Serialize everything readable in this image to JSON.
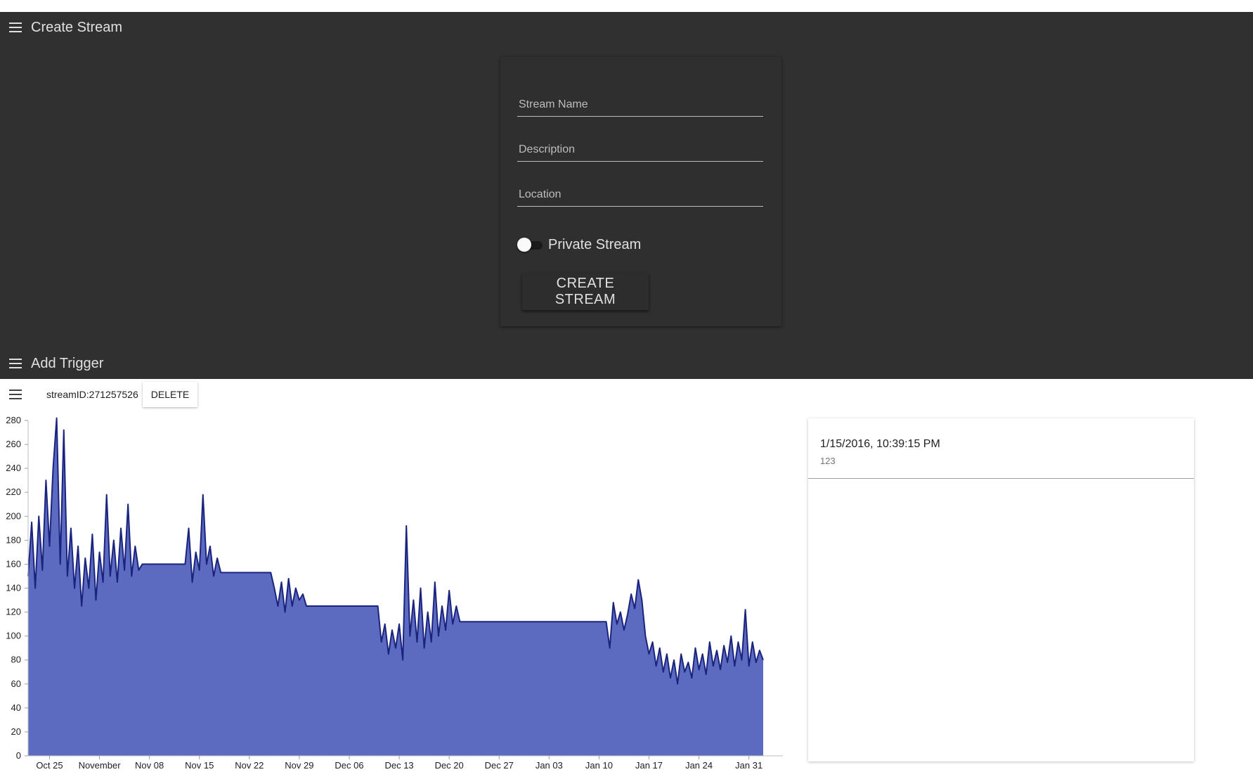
{
  "create_stream": {
    "title": "Create Stream",
    "stream_name_placeholder": "Stream Name",
    "description_placeholder": "Description",
    "location_placeholder": "Location",
    "private_label": "Private Stream",
    "private_enabled": false,
    "create_button": "CREATE STREAM"
  },
  "add_trigger": {
    "title": "Add Trigger"
  },
  "stream_toolbar": {
    "stream_id": "streamID:271257526",
    "delete_button": "DELETE"
  },
  "side_list": {
    "items": [
      {
        "timestamp": "1/15/2016, 10:39:15 PM",
        "value": "123"
      }
    ]
  },
  "colors": {
    "dark_background": "#303030",
    "area_fill": "#5c6bc0",
    "line_stroke": "#1a237e"
  },
  "chart_data": {
    "type": "area",
    "title": "",
    "xlabel": "",
    "ylabel": "",
    "ylim": [
      0,
      280
    ],
    "yticks": [
      0,
      20,
      40,
      60,
      80,
      100,
      120,
      140,
      160,
      180,
      200,
      220,
      240,
      260,
      280
    ],
    "x_range": [
      "2015-10-22",
      "2016-02-02"
    ],
    "xticks": [
      {
        "date": "2015-10-25",
        "label": "Oct 25"
      },
      {
        "date": "2015-11-01",
        "label": "November"
      },
      {
        "date": "2015-11-08",
        "label": "Nov 08"
      },
      {
        "date": "2015-11-15",
        "label": "Nov 15"
      },
      {
        "date": "2015-11-22",
        "label": "Nov 22"
      },
      {
        "date": "2015-11-29",
        "label": "Nov 29"
      },
      {
        "date": "2015-12-06",
        "label": "Dec 06"
      },
      {
        "date": "2015-12-13",
        "label": "Dec 13"
      },
      {
        "date": "2015-12-20",
        "label": "Dec 20"
      },
      {
        "date": "2015-12-27",
        "label": "Dec 27"
      },
      {
        "date": "2016-01-03",
        "label": "Jan 03"
      },
      {
        "date": "2016-01-10",
        "label": "Jan 10"
      },
      {
        "date": "2016-01-17",
        "label": "Jan 17"
      },
      {
        "date": "2016-01-24",
        "label": "Jan 24"
      },
      {
        "date": "2016-01-31",
        "label": "Jan 31"
      }
    ],
    "grid": false,
    "legend": "none",
    "series": [
      {
        "points": [
          [
            "2015-10-22",
            150
          ],
          [
            "2015-10-22T12",
            195
          ],
          [
            "2015-10-23",
            140
          ],
          [
            "2015-10-23T12",
            200
          ],
          [
            "2015-10-24",
            155
          ],
          [
            "2015-10-24T12",
            230
          ],
          [
            "2015-10-25",
            175
          ],
          [
            "2015-10-25T12",
            240
          ],
          [
            "2015-10-26",
            282
          ],
          [
            "2015-10-26T12",
            160
          ],
          [
            "2015-10-27",
            272
          ],
          [
            "2015-10-27T12",
            150
          ],
          [
            "2015-10-28",
            190
          ],
          [
            "2015-10-28T12",
            140
          ],
          [
            "2015-10-29",
            175
          ],
          [
            "2015-10-29T12",
            125
          ],
          [
            "2015-10-30",
            165
          ],
          [
            "2015-10-30T12",
            140
          ],
          [
            "2015-10-31",
            185
          ],
          [
            "2015-10-31T12",
            130
          ],
          [
            "2015-11-01",
            170
          ],
          [
            "2015-11-01T12",
            145
          ],
          [
            "2015-11-02",
            218
          ],
          [
            "2015-11-02T12",
            150
          ],
          [
            "2015-11-03",
            180
          ],
          [
            "2015-11-03T12",
            145
          ],
          [
            "2015-11-04",
            190
          ],
          [
            "2015-11-04T12",
            155
          ],
          [
            "2015-11-05",
            210
          ],
          [
            "2015-11-05T12",
            150
          ],
          [
            "2015-11-06",
            175
          ],
          [
            "2015-11-06T12",
            155
          ],
          [
            "2015-11-07",
            160
          ],
          [
            "2015-11-13",
            160
          ],
          [
            "2015-11-13T12",
            190
          ],
          [
            "2015-11-14",
            145
          ],
          [
            "2015-11-14T12",
            170
          ],
          [
            "2015-11-15",
            155
          ],
          [
            "2015-11-15T12",
            218
          ],
          [
            "2015-11-16",
            160
          ],
          [
            "2015-11-16T12",
            175
          ],
          [
            "2015-11-17",
            150
          ],
          [
            "2015-11-17T12",
            165
          ],
          [
            "2015-11-18",
            153
          ],
          [
            "2015-11-25",
            153
          ],
          [
            "2015-11-25T12",
            140
          ],
          [
            "2015-11-26",
            125
          ],
          [
            "2015-11-26T12",
            145
          ],
          [
            "2015-11-27",
            120
          ],
          [
            "2015-11-27T12",
            148
          ],
          [
            "2015-11-28",
            125
          ],
          [
            "2015-11-28T12",
            140
          ],
          [
            "2015-11-29",
            130
          ],
          [
            "2015-11-29T12",
            135
          ],
          [
            "2015-11-30",
            125
          ],
          [
            "2015-12-10",
            125
          ],
          [
            "2015-12-10T12",
            95
          ],
          [
            "2015-12-11",
            110
          ],
          [
            "2015-12-11T12",
            85
          ],
          [
            "2015-12-12",
            105
          ],
          [
            "2015-12-12T12",
            90
          ],
          [
            "2015-12-13",
            110
          ],
          [
            "2015-12-13T12",
            80
          ],
          [
            "2015-12-14",
            192
          ],
          [
            "2015-12-14T12",
            100
          ],
          [
            "2015-12-15",
            130
          ],
          [
            "2015-12-15T12",
            95
          ],
          [
            "2015-12-16",
            140
          ],
          [
            "2015-12-16T12",
            90
          ],
          [
            "2015-12-17",
            120
          ],
          [
            "2015-12-17T12",
            95
          ],
          [
            "2015-12-18",
            145
          ],
          [
            "2015-12-18T12",
            100
          ],
          [
            "2015-12-19",
            125
          ],
          [
            "2015-12-19T12",
            105
          ],
          [
            "2015-12-20",
            138
          ],
          [
            "2015-12-20T12",
            110
          ],
          [
            "2015-12-21",
            125
          ],
          [
            "2015-12-21T12",
            112
          ],
          [
            "2016-01-11",
            112
          ],
          [
            "2016-01-11T12",
            90
          ],
          [
            "2016-01-12",
            128
          ],
          [
            "2016-01-12T12",
            110
          ],
          [
            "2016-01-13",
            120
          ],
          [
            "2016-01-13T12",
            105
          ],
          [
            "2016-01-14",
            118
          ],
          [
            "2016-01-14T12",
            135
          ],
          [
            "2016-01-15",
            123
          ],
          [
            "2016-01-15T12",
            147
          ],
          [
            "2016-01-16",
            130
          ],
          [
            "2016-01-16T12",
            100
          ],
          [
            "2016-01-17",
            85
          ],
          [
            "2016-01-17T12",
            95
          ],
          [
            "2016-01-18",
            75
          ],
          [
            "2016-01-18T12",
            90
          ],
          [
            "2016-01-19",
            70
          ],
          [
            "2016-01-19T12",
            85
          ],
          [
            "2016-01-20",
            65
          ],
          [
            "2016-01-20T12",
            80
          ],
          [
            "2016-01-21",
            60
          ],
          [
            "2016-01-21T12",
            85
          ],
          [
            "2016-01-22",
            70
          ],
          [
            "2016-01-22T12",
            78
          ],
          [
            "2016-01-23",
            65
          ],
          [
            "2016-01-23T12",
            90
          ],
          [
            "2016-01-24",
            72
          ],
          [
            "2016-01-24T12",
            85
          ],
          [
            "2016-01-25",
            68
          ],
          [
            "2016-01-25T12",
            95
          ],
          [
            "2016-01-26",
            75
          ],
          [
            "2016-01-26T12",
            88
          ],
          [
            "2016-01-27",
            72
          ],
          [
            "2016-01-27T12",
            92
          ],
          [
            "2016-01-28",
            78
          ],
          [
            "2016-01-28T12",
            100
          ],
          [
            "2016-01-29",
            75
          ],
          [
            "2016-01-29T12",
            95
          ],
          [
            "2016-01-30",
            80
          ],
          [
            "2016-01-30T12",
            122
          ],
          [
            "2016-01-31",
            75
          ],
          [
            "2016-01-31T12",
            95
          ],
          [
            "2016-02-01",
            78
          ],
          [
            "2016-02-01T12",
            88
          ],
          [
            "2016-02-02",
            80
          ]
        ]
      }
    ]
  }
}
